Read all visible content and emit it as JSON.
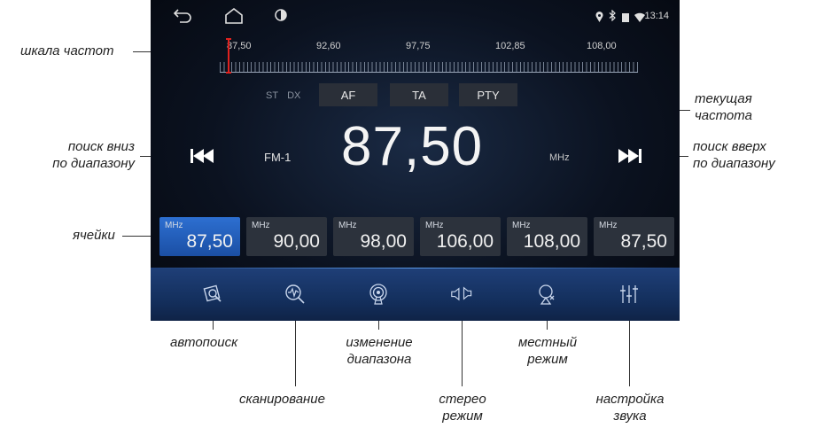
{
  "statusbar": {
    "back_icon": "back-arrow-icon",
    "home_icon": "home-icon",
    "brightness_icon": "brightness-icon",
    "location_icon": "location-icon",
    "bluetooth_icon": "bluetooth-icon",
    "signal_icon": "signal-icon",
    "wifi_icon": "wifi-icon",
    "time": "13:14"
  },
  "scale": {
    "labels": [
      "87,50",
      "92,60",
      "97,75",
      "102,85",
      "108,00"
    ],
    "needle_value": "87,50"
  },
  "tags": {
    "st": "ST",
    "dx": "DX"
  },
  "buttons": {
    "af": "AF",
    "ta": "TA",
    "pty": "PTY"
  },
  "band": "FM-1",
  "frequency": "87,50",
  "unit": "MHz",
  "presets": [
    {
      "unit": "MHz",
      "value": "87,50",
      "active": true
    },
    {
      "unit": "MHz",
      "value": "90,00"
    },
    {
      "unit": "MHz",
      "value": "98,00"
    },
    {
      "unit": "MHz",
      "value": "106,00"
    },
    {
      "unit": "MHz",
      "value": "108,00"
    },
    {
      "unit": "MHz",
      "value": "87,50"
    }
  ],
  "toolbar": {
    "icons": [
      "autosearch-icon",
      "scan-icon",
      "band-switch-icon",
      "stereo-icon",
      "local-mode-icon",
      "equalizer-icon"
    ]
  },
  "annotations": {
    "scale": "шкала частот",
    "current_freq": [
      "текущая",
      "частота"
    ],
    "seek_down": [
      "поиск вниз",
      "по диапазону"
    ],
    "seek_up": [
      "поиск вверх",
      "по диапазону"
    ],
    "cells": "ячейки",
    "autosearch": "автопоиск",
    "scanning": "сканирование",
    "band_change": [
      "изменение",
      "диапазона"
    ],
    "stereo": [
      "стерео",
      "режим"
    ],
    "local": [
      "местный",
      "режим"
    ],
    "sound": [
      "настройка",
      "звука"
    ]
  }
}
